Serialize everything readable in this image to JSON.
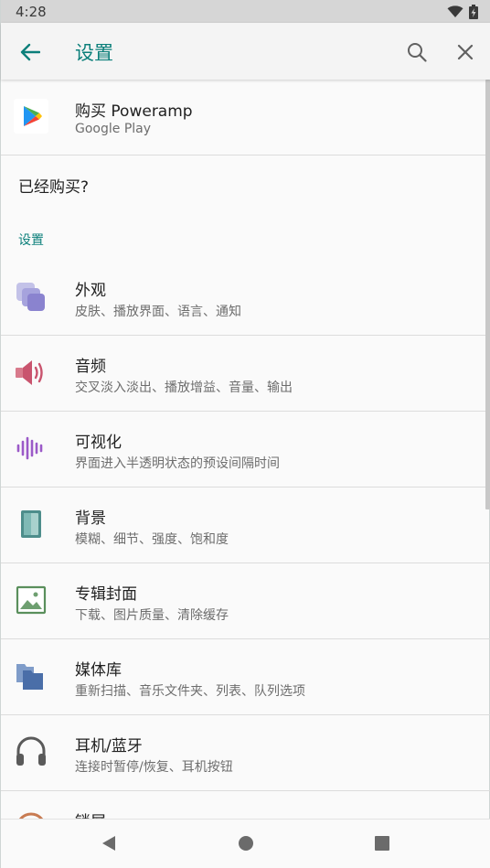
{
  "status_bar": {
    "time": "4:28",
    "icons": [
      "wifi-icon",
      "battery-charging-icon"
    ]
  },
  "app_bar": {
    "title": "设置",
    "back_icon": "arrow-left-icon",
    "search_icon": "search-icon",
    "close_icon": "close-icon",
    "accent_color": "#0b7f7a"
  },
  "purchase": {
    "title": "购买 Poweramp",
    "subtitle": "Google Play",
    "icon": "google-play-icon"
  },
  "already_bought": {
    "label": "已经购买?"
  },
  "section": {
    "label": "设置"
  },
  "settings": [
    {
      "title": "外观",
      "subtitle": "皮肤、播放界面、语言、通知",
      "icon": "appearance-icon"
    },
    {
      "title": "音频",
      "subtitle": "交叉淡入淡出、播放增益、音量、输出",
      "icon": "speaker-icon"
    },
    {
      "title": "可视化",
      "subtitle": "界面进入半透明状态的预设间隔时间",
      "icon": "waveform-icon"
    },
    {
      "title": "背景",
      "subtitle": "模糊、细节、强度、饱和度",
      "icon": "background-icon"
    },
    {
      "title": "专辑封面",
      "subtitle": "下载、图片质量、清除缓存",
      "icon": "album-art-icon"
    },
    {
      "title": "媒体库",
      "subtitle": "重新扫描、音乐文件夹、列表、队列选项",
      "icon": "library-icon"
    },
    {
      "title": "耳机/蓝牙",
      "subtitle": "连接时暂停/恢复、耳机按钮",
      "icon": "headphones-icon"
    },
    {
      "title": "锁屏",
      "subtitle": "",
      "icon": "lock-screen-icon"
    }
  ],
  "nav_bar": {
    "icons": [
      "nav-back-icon",
      "nav-home-icon",
      "nav-recents-icon"
    ]
  }
}
